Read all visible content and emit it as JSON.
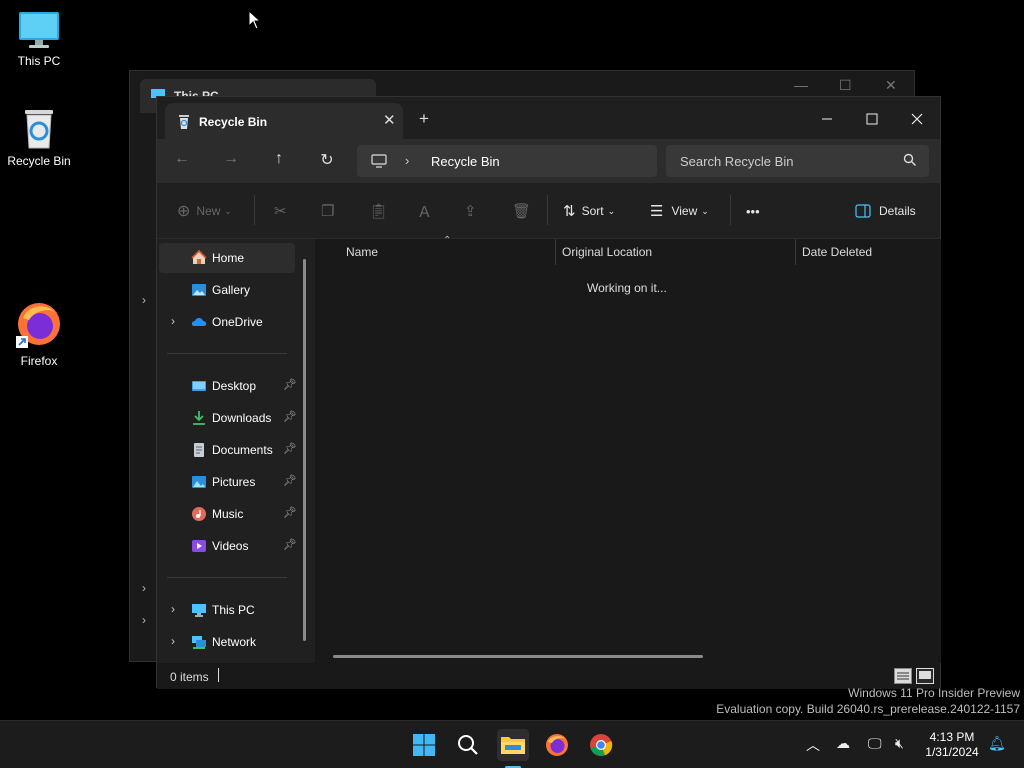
{
  "desktop": {
    "icons": [
      {
        "label": "This PC"
      },
      {
        "label": "Recycle Bin"
      },
      {
        "label": "Firefox"
      }
    ]
  },
  "back_window": {
    "tab_title": "This PC"
  },
  "window": {
    "tab_title": "Recycle Bin",
    "new_tab_symbol": "+",
    "address": {
      "crumb": "Recycle Bin"
    },
    "search": {
      "placeholder": "Search Recycle Bin"
    },
    "commands": {
      "new_label": "New",
      "sort_label": "Sort",
      "view_label": "View",
      "more_label": "•••",
      "details_label": "Details"
    },
    "sidebar": {
      "items": [
        {
          "label": "Home"
        },
        {
          "label": "Gallery"
        },
        {
          "label": "OneDrive"
        },
        {
          "label": "Desktop"
        },
        {
          "label": "Downloads"
        },
        {
          "label": "Documents"
        },
        {
          "label": "Pictures"
        },
        {
          "label": "Music"
        },
        {
          "label": "Videos"
        },
        {
          "label": "This PC"
        },
        {
          "label": "Network"
        }
      ]
    },
    "columns": [
      "Name",
      "Original Location",
      "Date Deleted"
    ],
    "working_text": "Working on it...",
    "status": {
      "item_count": "0 items"
    }
  },
  "watermark": {
    "line1": "Windows 11 Pro Insider Preview",
    "line2": "Evaluation copy. Build 26040.rs_prerelease.240122-1157"
  },
  "taskbar": {
    "time": "4:13 PM",
    "date": "1/31/2024"
  },
  "colors": {
    "accent": "#4cc2ff",
    "folder": "#f4c84a"
  }
}
